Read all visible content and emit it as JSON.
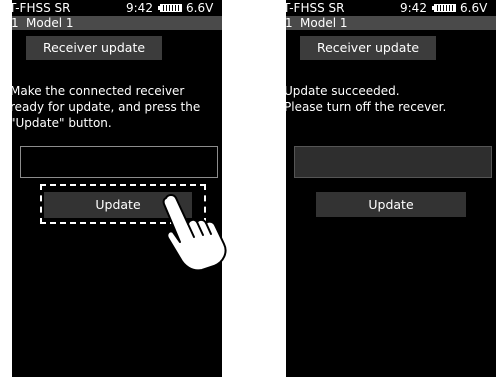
{
  "screens": [
    {
      "status": {
        "system": "T-FHSS SR",
        "time": "9:42",
        "battery_icon": "battery-icon",
        "voltage": "6.6V"
      },
      "model": {
        "number": "1",
        "name": "Model 1"
      },
      "title": "Receiver update",
      "message_lines": [
        "Make the connected receiver",
        "ready for update, and press the",
        "\"Update\" button."
      ],
      "button_label": "Update",
      "pointer_icon": "hand-pointer-icon"
    },
    {
      "status": {
        "system": "T-FHSS SR",
        "time": "9:42",
        "battery_icon": "battery-icon",
        "voltage": "6.6V"
      },
      "model": {
        "number": "1",
        "name": "Model 1"
      },
      "title": "Receiver update",
      "message_lines": [
        "Update succeeded.",
        "Please turn off the recever."
      ],
      "button_label": "Update"
    }
  ]
}
